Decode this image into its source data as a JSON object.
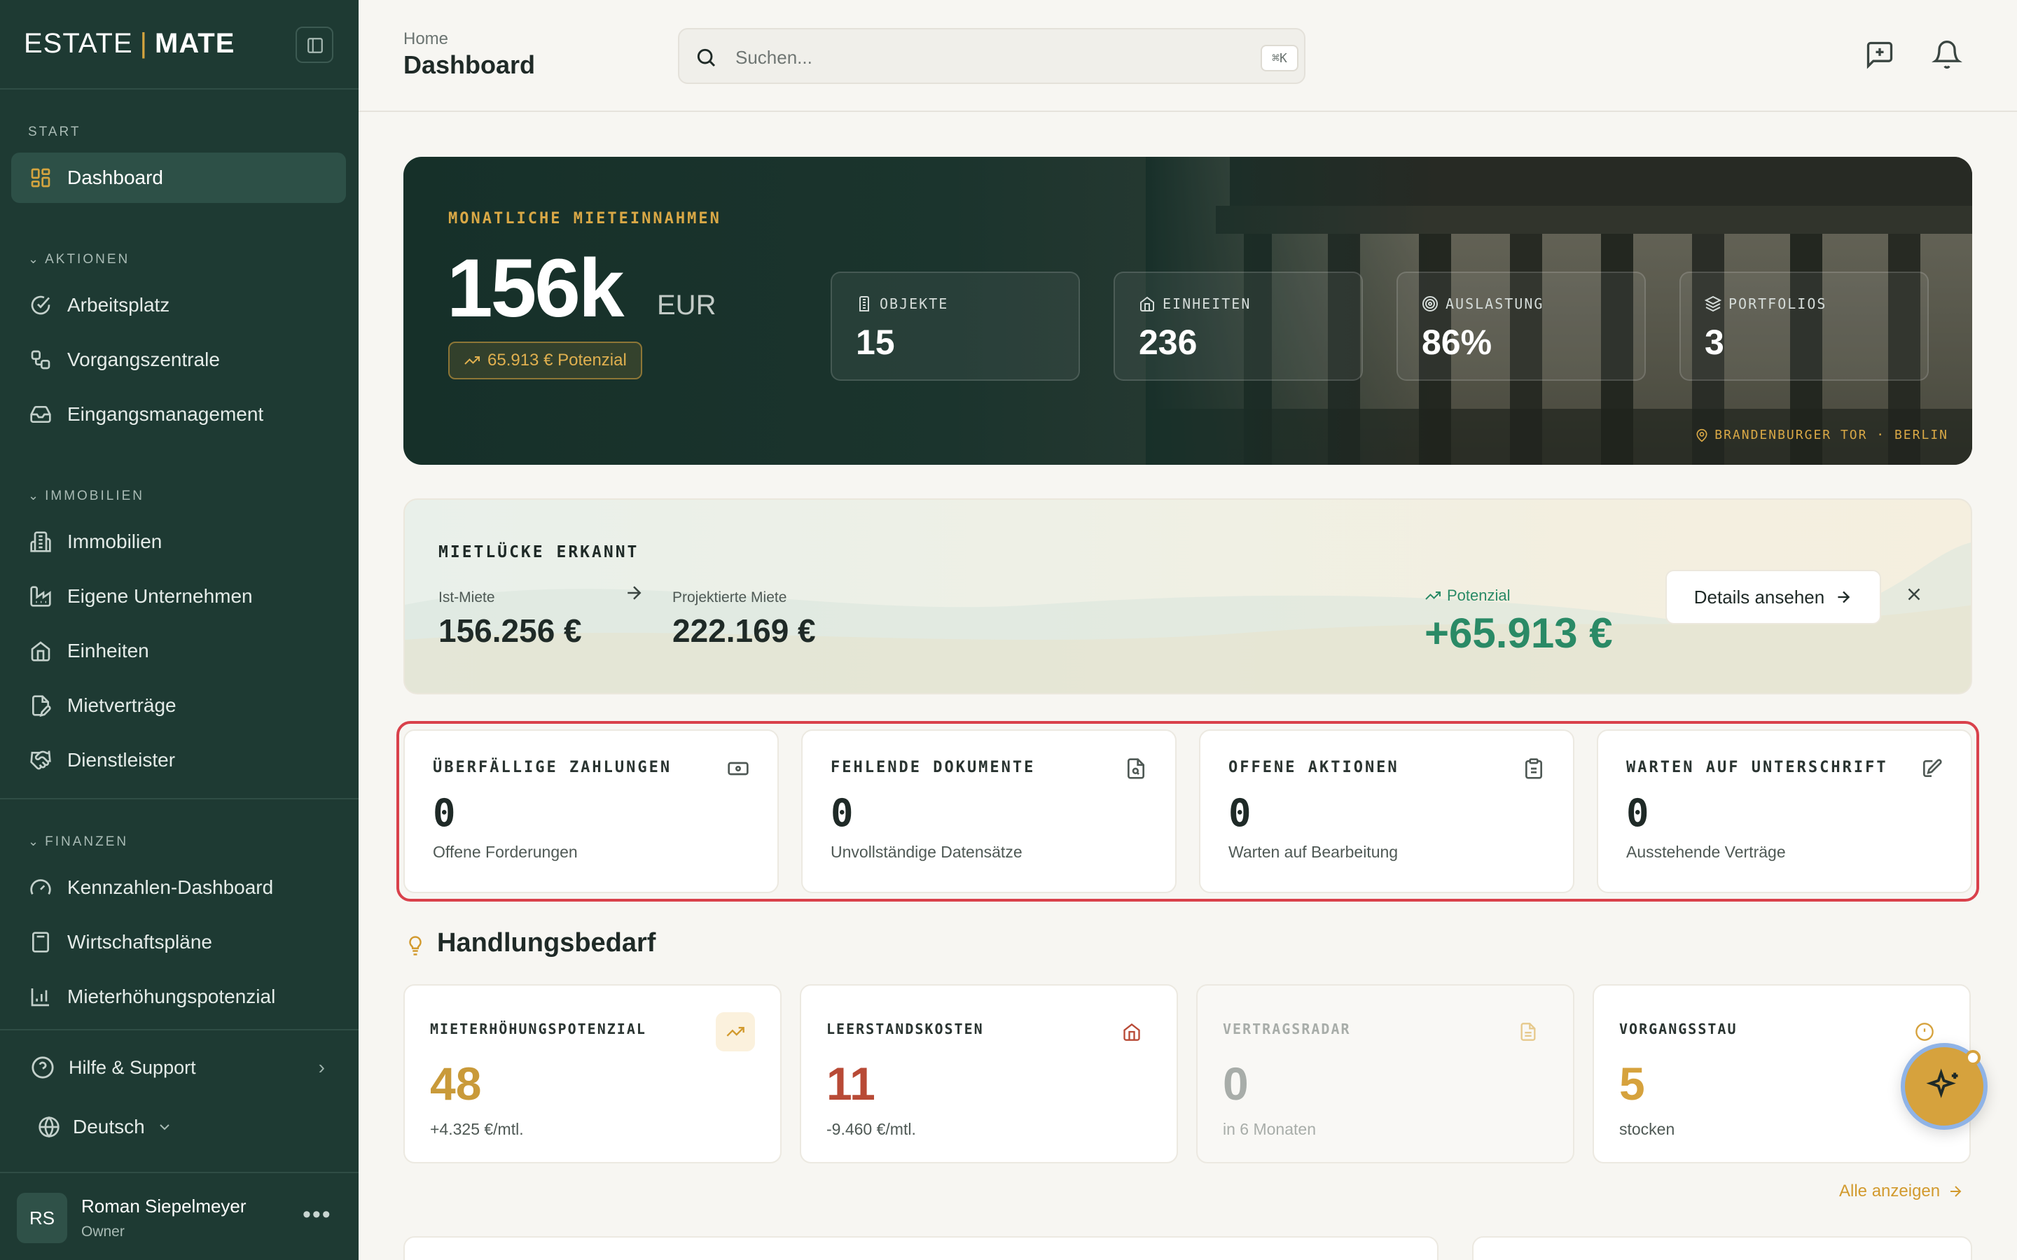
{
  "brand": {
    "part1": "ESTATE",
    "separator": "|",
    "part2": "MATE"
  },
  "sidebar": {
    "sections": {
      "start": "START",
      "aktionen": "AKTIONEN",
      "immobilien": "IMMOBILIEN",
      "finanzen": "FINANZEN"
    },
    "items": {
      "dashboard": "Dashboard",
      "arbeitsplatz": "Arbeitsplatz",
      "vorgangszentrale": "Vorgangszentrale",
      "eingangsmanagement": "Eingangsmanagement",
      "immobilien": "Immobilien",
      "eigene_unternehmen": "Eigene Unternehmen",
      "einheiten": "Einheiten",
      "mietvertraege": "Mietverträge",
      "dienstleister": "Dienstleister",
      "kennzahlen": "Kennzahlen-Dashboard",
      "wirtschaftsplaene": "Wirtschaftspläne",
      "mieterhoehungspotenzial": "Mieterhöhungspotenzial"
    },
    "help": "Hilfe & Support",
    "language": "Deutsch",
    "user": {
      "initials": "RS",
      "name": "Roman Siepelmeyer",
      "role": "Owner"
    }
  },
  "header": {
    "breadcrumb": "Home",
    "title": "Dashboard",
    "search_placeholder": "Suchen...",
    "search_shortcut": "⌘K"
  },
  "hero": {
    "label": "MONATLICHE MIETEINNAHMEN",
    "value": "156k",
    "unit": "EUR",
    "potential": "65.913 € Potenzial",
    "stats": [
      {
        "label": "OBJEKTE",
        "value": "15",
        "icon": "building-icon"
      },
      {
        "label": "EINHEITEN",
        "value": "236",
        "icon": "home-icon"
      },
      {
        "label": "AUSLASTUNG",
        "value": "86%",
        "icon": "target-icon"
      },
      {
        "label": "PORTFOLIOS",
        "value": "3",
        "icon": "layers-icon"
      }
    ],
    "location": "BRANDENBURGER TOR · BERLIN"
  },
  "rent_gap": {
    "title": "MIETLÜCKE ERKANNT",
    "current_label": "Ist-Miete",
    "current_value": "156.256 €",
    "projected_label": "Projektierte Miete",
    "projected_value": "222.169 €",
    "potential_label": "Potenzial",
    "potential_value": "+65.913 €",
    "button": "Details ansehen"
  },
  "alerts": [
    {
      "label": "ÜBERFÄLLIGE ZAHLUNGEN",
      "value": "0",
      "sub": "Offene Forderungen",
      "icon": "banknote-icon"
    },
    {
      "label": "FEHLENDE DOKUMENTE",
      "value": "0",
      "sub": "Unvollständige Datensätze",
      "icon": "file-search-icon"
    },
    {
      "label": "OFFENE AKTIONEN",
      "value": "0",
      "sub": "Warten auf Bearbeitung",
      "icon": "clipboard-icon"
    },
    {
      "label": "WARTEN AUF UNTERSCHRIFT",
      "value": "0",
      "sub": "Ausstehende Verträge",
      "icon": "signature-icon"
    }
  ],
  "action_needed": {
    "title": "Handlungsbedarf",
    "cards": [
      {
        "label": "MIETERHÖHUNGSPOTENZIAL",
        "value": "48",
        "sub": "+4.325 €/mtl.",
        "color": "#c99a3a",
        "icon": "trending-up-icon"
      },
      {
        "label": "LEERSTANDSKOSTEN",
        "value": "11",
        "sub": "-9.460 €/mtl.",
        "color": "#b84a36",
        "icon": "home-icon"
      },
      {
        "label": "VERTRAGSRADAR",
        "value": "0",
        "sub": "in 6 Monaten",
        "color": "#a8ada9",
        "icon": "document-icon"
      },
      {
        "label": "VORGANGSSTAU",
        "value": "5",
        "sub": "stocken",
        "color": "#d6a23d",
        "icon": "alert-circle-icon"
      }
    ],
    "show_all": "Alle anzeigen"
  },
  "colors": {
    "sidebar": "#1e3a33",
    "accent": "#d4a43f",
    "positive": "#2a8a66",
    "danger": "#d9414b"
  }
}
